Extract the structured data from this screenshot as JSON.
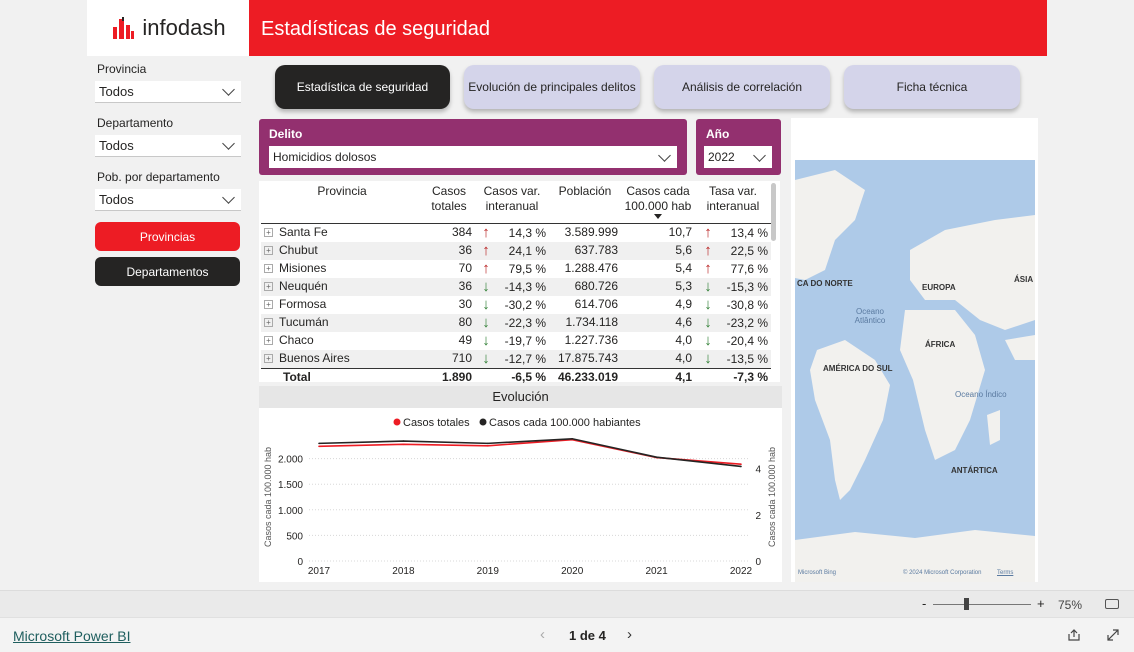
{
  "logo": {
    "text": "infodash"
  },
  "header": {
    "title": "Estadísticas de seguridad"
  },
  "filters": [
    {
      "label": "Provincia",
      "value": "Todos"
    },
    {
      "label": "Departamento",
      "value": "Todos"
    },
    {
      "label": "Pob. por departamento",
      "value": "Todos"
    }
  ],
  "side_buttons": {
    "provincias": "Provincias",
    "departamentos": "Departamentos"
  },
  "tabs": [
    {
      "label": "Estadística de seguridad"
    },
    {
      "label": "Evolución de principales delitos"
    },
    {
      "label": "Análisis de correlación"
    },
    {
      "label": "Ficha técnica"
    }
  ],
  "delito": {
    "label": "Delito",
    "value": "Homicidios dolosos"
  },
  "anio": {
    "label": "Año",
    "value": "2022"
  },
  "table": {
    "headers": {
      "provincia": "Provincia",
      "casos": "Casos totales",
      "casos_var": "Casos var. interanual",
      "poblacion": "Población",
      "cada100k": "Casos cada 100.000 hab",
      "tasa_var": "Tasa var. interanual"
    },
    "rows": [
      {
        "provincia": "Santa Fe",
        "casos": "384",
        "casos_dir": "up",
        "casos_var": "14,3 %",
        "poblacion": "3.589.999",
        "cada100k": "10,7",
        "tasa_dir": "up",
        "tasa_var": "13,4 %"
      },
      {
        "provincia": "Chubut",
        "casos": "36",
        "casos_dir": "up",
        "casos_var": "24,1 %",
        "poblacion": "637.783",
        "cada100k": "5,6",
        "tasa_dir": "up",
        "tasa_var": "22,5 %"
      },
      {
        "provincia": "Misiones",
        "casos": "70",
        "casos_dir": "up",
        "casos_var": "79,5 %",
        "poblacion": "1.288.476",
        "cada100k": "5,4",
        "tasa_dir": "up",
        "tasa_var": "77,6 %"
      },
      {
        "provincia": "Neuquén",
        "casos": "36",
        "casos_dir": "down",
        "casos_var": "-14,3 %",
        "poblacion": "680.726",
        "cada100k": "5,3",
        "tasa_dir": "down",
        "tasa_var": "-15,3 %"
      },
      {
        "provincia": "Formosa",
        "casos": "30",
        "casos_dir": "down",
        "casos_var": "-30,2 %",
        "poblacion": "614.706",
        "cada100k": "4,9",
        "tasa_dir": "down",
        "tasa_var": "-30,8 %"
      },
      {
        "provincia": "Tucumán",
        "casos": "80",
        "casos_dir": "down",
        "casos_var": "-22,3 %",
        "poblacion": "1.734.118",
        "cada100k": "4,6",
        "tasa_dir": "down",
        "tasa_var": "-23,2 %"
      },
      {
        "provincia": "Chaco",
        "casos": "49",
        "casos_dir": "down",
        "casos_var": "-19,7 %",
        "poblacion": "1.227.736",
        "cada100k": "4,0",
        "tasa_dir": "down",
        "tasa_var": "-20,4 %"
      },
      {
        "provincia": "Buenos Aires",
        "casos": "710",
        "casos_dir": "down",
        "casos_var": "-12,7 %",
        "poblacion": "17.875.743",
        "cada100k": "4,0",
        "tasa_dir": "down",
        "tasa_var": "-13,5 %"
      }
    ],
    "total": {
      "provincia": "Total",
      "casos": "1.890",
      "casos_var": "-6,5 %",
      "poblacion": "46.233.019",
      "cada100k": "4,1",
      "tasa_var": "-7,3 %"
    }
  },
  "chart_data": {
    "type": "line",
    "title": "Evolución",
    "categories": [
      "2017",
      "2018",
      "2019",
      "2020",
      "2021",
      "2022"
    ],
    "series": [
      {
        "name": "Casos totales",
        "color": "#ed1c24",
        "axis": "left",
        "values": [
          2240,
          2280,
          2250,
          2370,
          2020,
          1890
        ]
      },
      {
        "name": "Casos cada 100.000 habiantes",
        "color": "#252423",
        "axis": "right",
        "values": [
          5.1,
          5.2,
          5.1,
          5.3,
          4.5,
          4.1
        ]
      }
    ],
    "ylabel_left": "Casos cada 100.000 hab",
    "ylabel_right": "Casos cada 100.000 hab",
    "y_left_ticks": [
      "0",
      "500",
      "1.000",
      "1.500",
      "2.000"
    ],
    "y_left_range": [
      0,
      2500
    ],
    "y_right_ticks": [
      "0",
      "2",
      "4"
    ],
    "y_right_range": [
      0,
      5.55
    ],
    "grid": true,
    "legend": "top-center"
  },
  "map": {
    "labels": [
      "CA DO NORTE",
      "EUROPA",
      "ÁSIA",
      "Oceano Atlântico",
      "ÁFRICA",
      "AMÉRICA DO SUL",
      "Oceano Índico",
      "ANTÁRTICA"
    ],
    "attribution_left": "Microsoft Bing",
    "attribution_right": "© 2024 Microsoft Corporation",
    "terms": "Terms"
  },
  "zoom": {
    "value": "75%",
    "minus": "-",
    "plus": "+"
  },
  "footer": {
    "brand": "Microsoft Power BI",
    "page": "1 de 4"
  },
  "colors": {
    "brand_red": "#ed1c24",
    "purple": "#93306f",
    "dark": "#252423",
    "tab_inactive": "#d4d4ea"
  }
}
